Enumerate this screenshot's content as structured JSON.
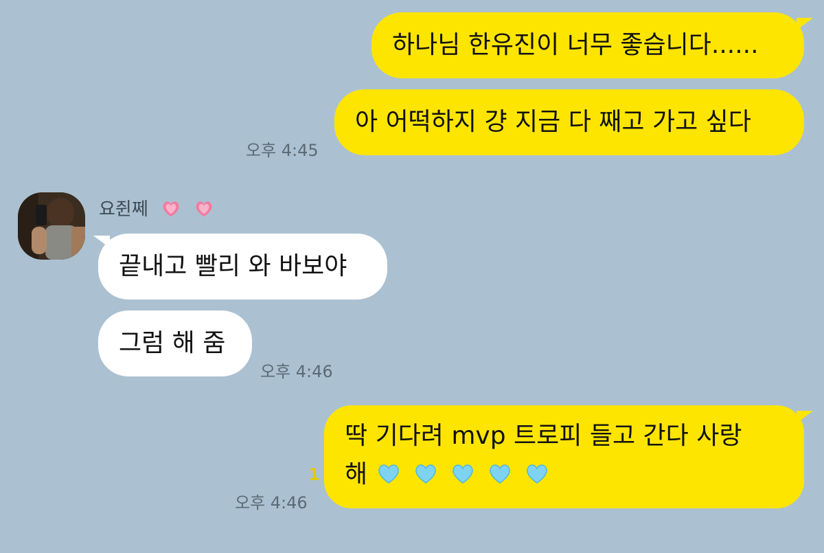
{
  "conversation": {
    "messages": [
      {
        "id": "m1",
        "from": "me",
        "text": "하나님 한유진이 너무 좋습니다......"
      },
      {
        "id": "m2",
        "from": "me",
        "text": "아 어떡하지 걍 지금 다 째고 가고 싶다",
        "time": "오후 4:45"
      },
      {
        "id": "m3",
        "from": "them",
        "sender": "요쥔쩨",
        "text": "끝내고 빨리 와 바보야"
      },
      {
        "id": "m4",
        "from": "them",
        "text": "그럼 해 줌",
        "time": "오후 4:46"
      },
      {
        "id": "m5",
        "from": "me",
        "line1": "딱 기다려 mvp 트로피 들고 간다 사랑",
        "line2": "해",
        "unread": "1",
        "time": "오후 4:46"
      }
    ]
  },
  "icons": {
    "avatar": "profile-photo",
    "sender_hearts": [
      "heart-with-sparkles",
      "heart-with-sparkles"
    ],
    "message_hearts": [
      "light-blue-heart",
      "light-blue-heart",
      "light-blue-heart",
      "light-blue-heart",
      "light-blue-heart"
    ]
  },
  "colors": {
    "background": "#abc1d1",
    "my_bubble": "#fee500",
    "their_bubble": "#ffffff",
    "unread": "#e8c800",
    "blue_heart": "#7fd3f2",
    "pink_heart": "#f27aa0"
  }
}
